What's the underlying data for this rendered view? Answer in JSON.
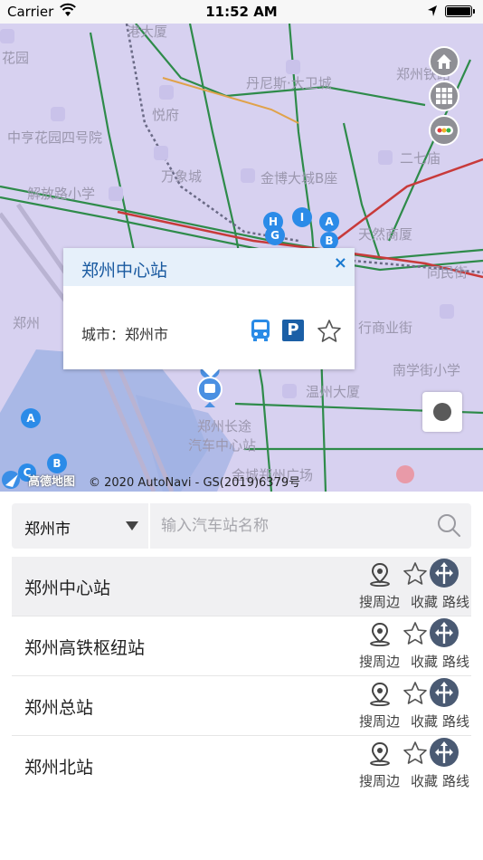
{
  "status_bar": {
    "carrier": "Carrier",
    "time": "11:52 AM"
  },
  "map": {
    "labels": [
      "港大厦",
      "花园",
      "丹尼斯·大卫城",
      "郑州铁路",
      "悦府",
      "中亨花园四号院",
      "万象城",
      "金博大城B座",
      "二七庙",
      "解放路小学",
      "天然商厦",
      "同民街",
      "郑州",
      "行商业街",
      "南学街小学",
      "温州大厦",
      "郑州长途",
      "汽车中心站",
      "金城郑州广场"
    ],
    "attribution_logo": "高德地图",
    "attribution_text": "© 2020 AutoNavi - GS(2019)6379号"
  },
  "popup": {
    "title": "郑州中心站",
    "close_symbol": "×",
    "city_label": "城市：郑州市",
    "parking_symbol": "P"
  },
  "search": {
    "city_value": "郑州市",
    "placeholder": "输入汽车站名称"
  },
  "actions": {
    "nearby": "搜周边",
    "favorite": "收藏",
    "route": "路线"
  },
  "stations": [
    {
      "name": "郑州中心站",
      "selected": true
    },
    {
      "name": "郑州高铁枢纽站",
      "selected": false
    },
    {
      "name": "郑州总站",
      "selected": false
    },
    {
      "name": "郑州北站",
      "selected": false
    }
  ],
  "colors": {
    "map_background": "#d7d1f0",
    "popup_header": "#e6f0fa",
    "popup_title": "#1a5aa0",
    "road_green": "#2e8b4a",
    "road_red": "#c83a3a",
    "route_icon": "#4a5a73"
  },
  "icons": {
    "map_controls": [
      "home-icon",
      "grid-icon",
      "traffic-light-icon"
    ],
    "popup": [
      "bus-icon",
      "parking-icon",
      "star-icon"
    ],
    "station_actions": [
      "location-pin-icon",
      "star-icon",
      "route-icon"
    ]
  }
}
